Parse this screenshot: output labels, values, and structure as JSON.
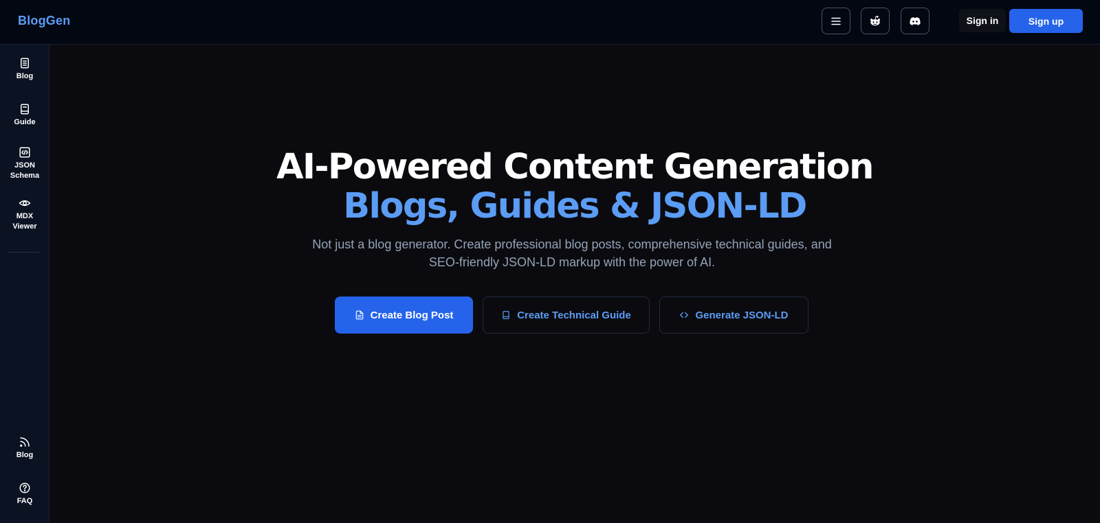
{
  "header": {
    "logo": "BlogGen",
    "menu_icon": "hamburger-menu-icon",
    "reddit_icon": "reddit-icon",
    "discord_icon": "discord-icon",
    "sign_in": "Sign in",
    "sign_up": "Sign up"
  },
  "sidebar": {
    "items": [
      {
        "label": "Blog",
        "icon": "document-icon"
      },
      {
        "label": "Guide",
        "icon": "book-icon"
      },
      {
        "label": "JSON\nSchema",
        "icon": "code-file-icon"
      },
      {
        "label": "MDX\nViewer",
        "icon": "eye-icon"
      }
    ],
    "bottom_items": [
      {
        "label": "Blog",
        "icon": "rss-icon"
      },
      {
        "label": "FAQ",
        "icon": "help-circle-icon"
      }
    ]
  },
  "hero": {
    "title_line1": "AI-Powered Content Generation",
    "title_line2": "Blogs, Guides & JSON-LD",
    "subtitle": "Not just a blog generator. Create professional blog posts, comprehensive technical guides, and SEO-friendly JSON-LD markup with the power of AI.",
    "buttons": [
      {
        "label": "Create Blog Post",
        "icon": "file-text-icon"
      },
      {
        "label": "Create Technical Guide",
        "icon": "book-icon"
      },
      {
        "label": "Generate JSON-LD",
        "icon": "code-icon"
      }
    ]
  },
  "colors": {
    "accent": "#2563eb",
    "accent_text": "#5b9cf5",
    "background": "#0b0b0f",
    "sidebar": "#0b1222",
    "subtitle": "#94a3b8"
  }
}
